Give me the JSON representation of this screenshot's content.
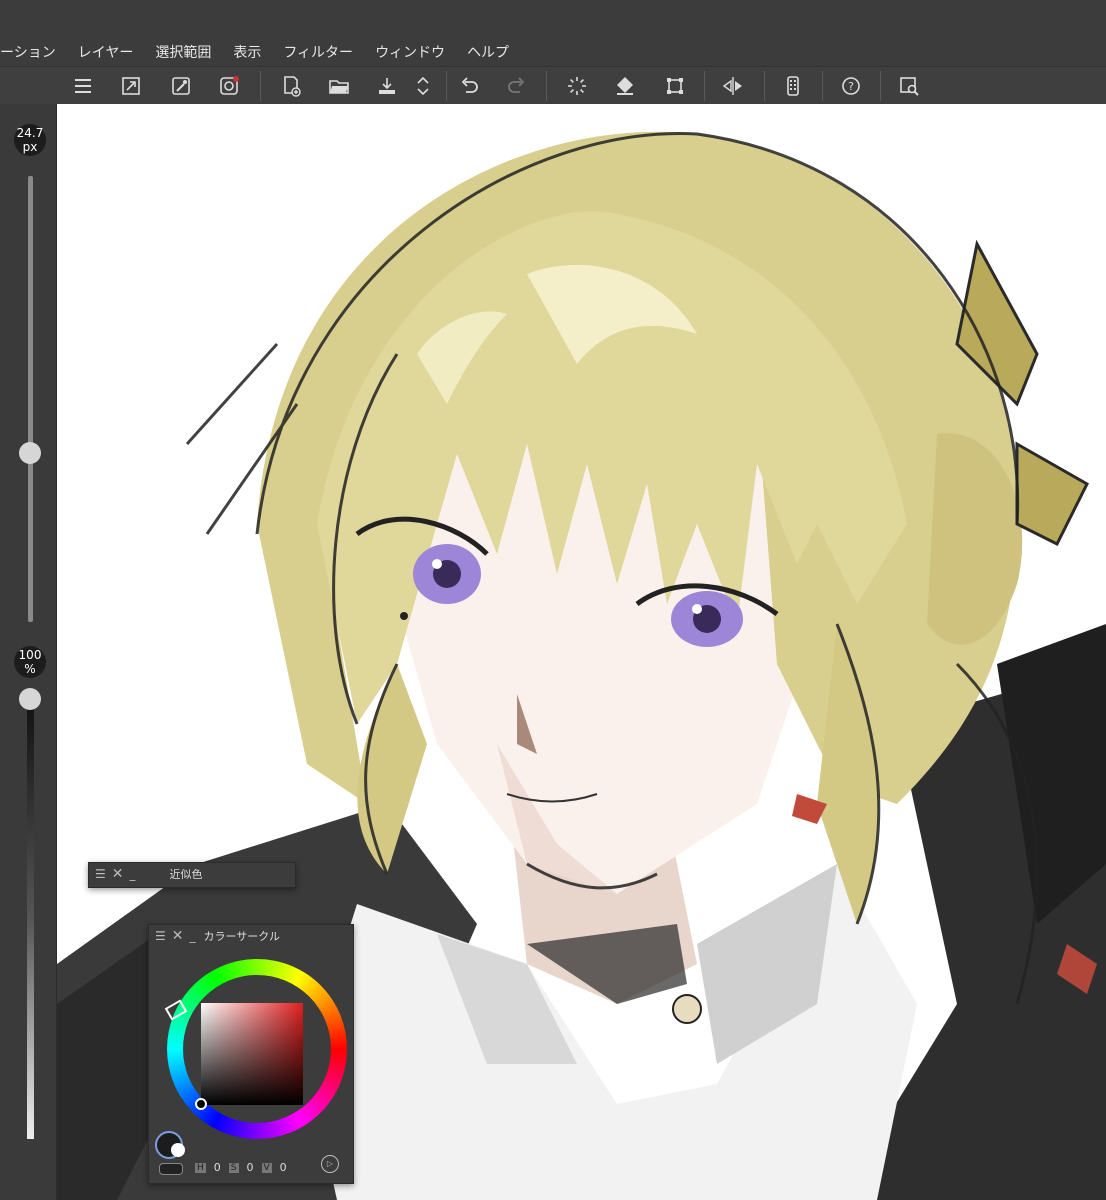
{
  "menu": [
    "ーション",
    "レイヤー",
    "選択範囲",
    "表示",
    "フィルター",
    "ウィンドウ",
    "ヘルプ"
  ],
  "left_panel": {
    "brush_size": "24.7",
    "brush_size_unit": "px",
    "opacity": "100",
    "opacity_unit": "%",
    "brush_size_slider_level": 0.38,
    "opacity_slider_level": 1.0
  },
  "panels": {
    "similar_color": {
      "title": "近似色"
    },
    "color_circle": {
      "title": "カラーサークル",
      "h_label": "H",
      "h_value": "0",
      "s_label": "S",
      "s_value": "0",
      "v_label": "V",
      "v_value": "0"
    }
  },
  "toolbar_icons": [
    "menu-icon",
    "resize-canvas-icon",
    "eyedropper-brush-icon",
    "record-icon",
    "new-canvas-icon",
    "open-folder-icon",
    "save-icon",
    "updown-icon",
    "undo-icon",
    "redo-icon",
    "transform-loading-icon",
    "fill-icon",
    "crop-icon",
    "flip-icon",
    "smartphone-icon",
    "help-icon",
    "search-icon"
  ],
  "colors": {
    "accent": "#cc3333",
    "background": "#3c3c3c",
    "hair": "#d8cf8e"
  }
}
